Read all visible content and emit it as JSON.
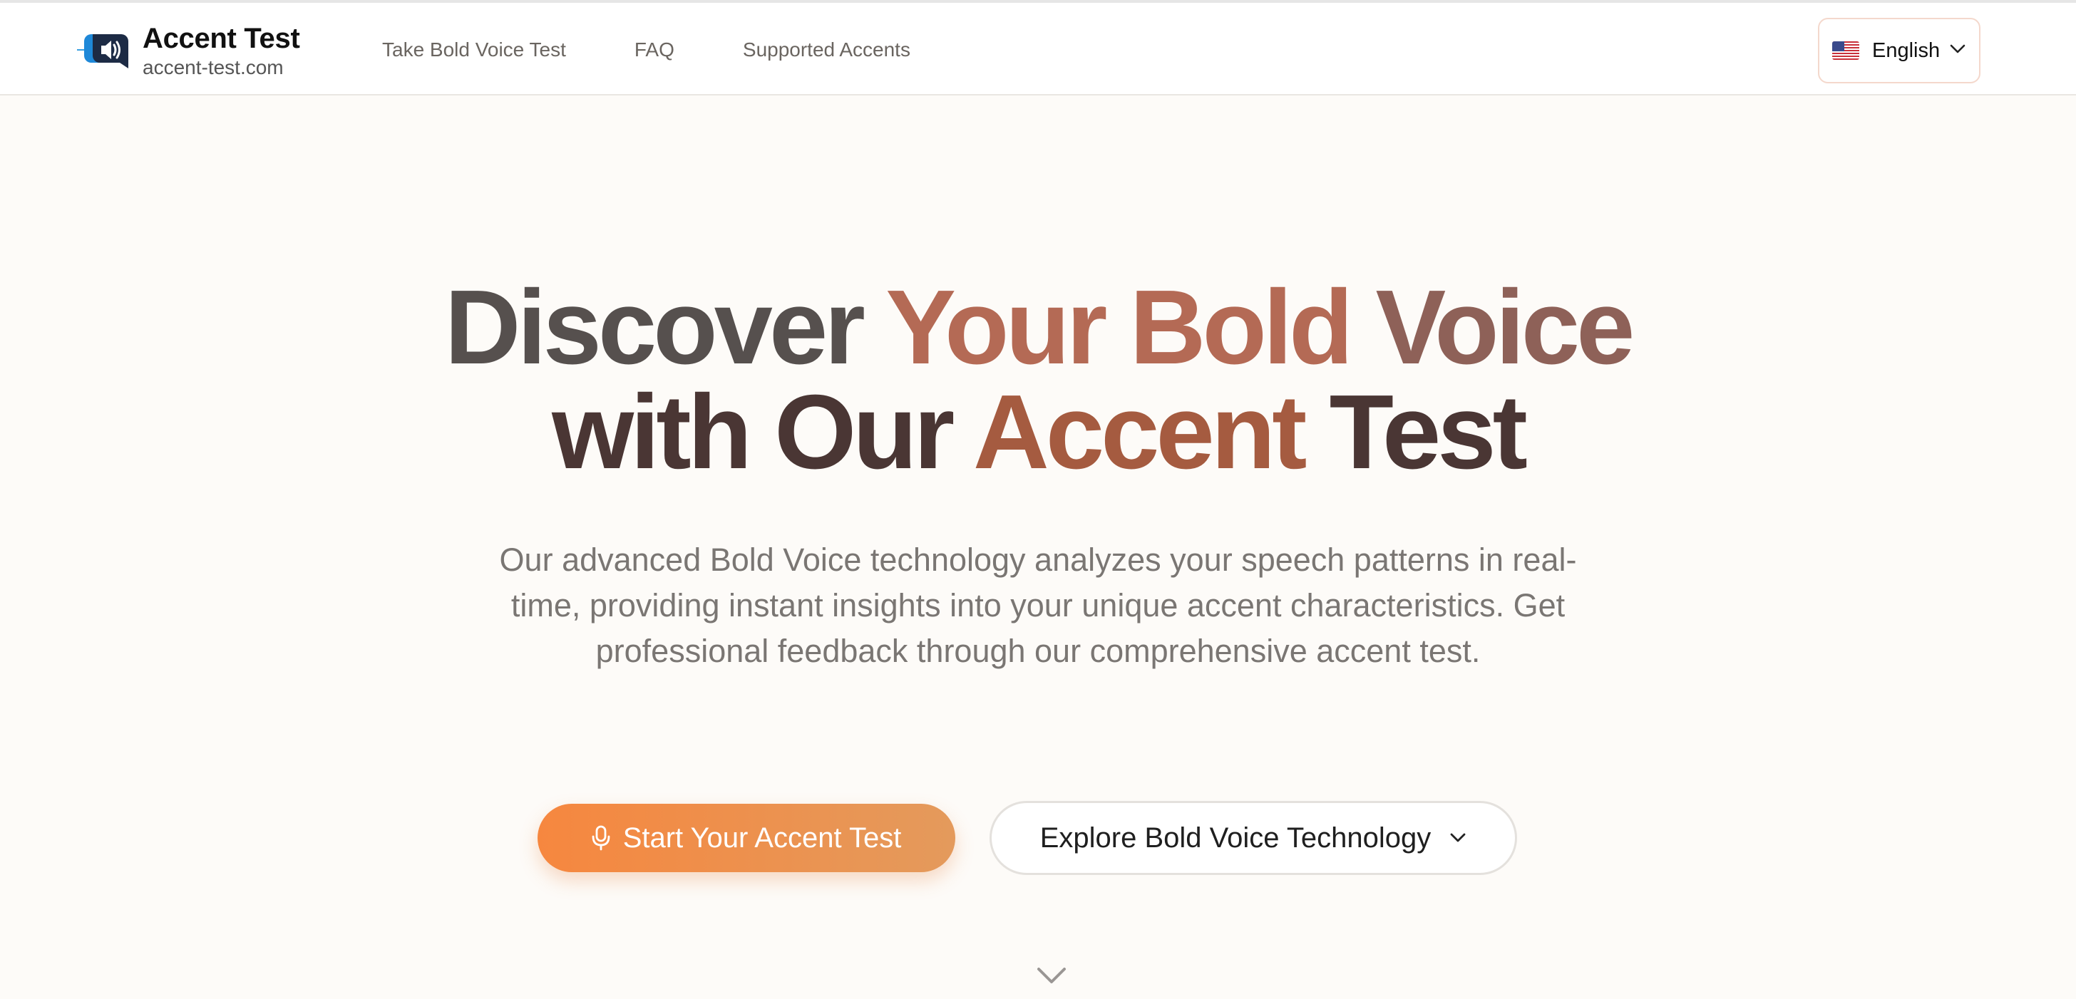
{
  "header": {
    "brand_title": "Accent Test",
    "brand_domain": "accent-test.com",
    "logo_icon": "speaker-chat-bubble-icon",
    "nav": [
      {
        "label": "Take Bold Voice Test"
      },
      {
        "label": "FAQ"
      },
      {
        "label": "Supported Accents"
      }
    ],
    "language": {
      "label": "English",
      "flag_icon": "us-flag-icon"
    }
  },
  "hero": {
    "headline_line1": [
      "Discover",
      "Your",
      "Bold",
      "Voice"
    ],
    "headline_line2": [
      "with",
      "Our",
      "Accent",
      "Test"
    ],
    "subtitle": "Our advanced Bold Voice technology analyzes your speech patterns in real-time, providing instant insights into your unique accent characteristics. Get professional feedback through our comprehensive accent test.",
    "primary_button": "Start Your Accent Test",
    "secondary_button": "Explore Bold Voice Technology"
  },
  "colors": {
    "accent_orange": "#f6873f",
    "accent_orange_end": "#e49a5c",
    "headline_dark": "#56504e",
    "headline_warm": "#b46a55",
    "background": "#fdfbf8"
  }
}
